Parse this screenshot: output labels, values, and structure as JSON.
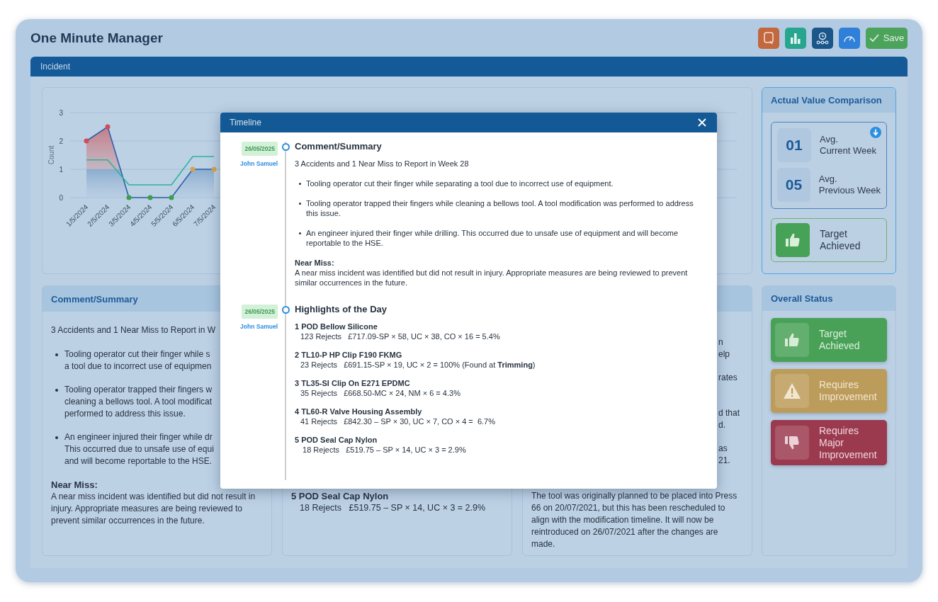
{
  "app": {
    "title": "One Minute Manager"
  },
  "toolbar": [
    {
      "kind": "note"
    },
    {
      "kind": "chart"
    },
    {
      "kind": "timeline"
    },
    {
      "kind": "gauge"
    },
    {
      "kind": "save",
      "label": "Save"
    }
  ],
  "section": {
    "title": "Incident"
  },
  "chart_card": {
    "chart_data": {
      "type": "area",
      "ylabel": "Count",
      "categories": [
        "1/5/2024",
        "2/5/2024",
        "3/5/2024",
        "4/5/2024",
        "5/5/2024",
        "6/5/2024",
        "7/5/2024"
      ],
      "yticks": [
        0,
        1,
        2,
        3
      ],
      "ylim": [
        0,
        3
      ],
      "series": [
        {
          "color": "#2f5ea8",
          "values": [
            2,
            2.5,
            0,
            0,
            0,
            1,
            1
          ],
          "marker": true,
          "type": "area"
        },
        {
          "color": "#2bb39a",
          "values": [
            1.33,
            1.33,
            0.45,
            0.45,
            0.45,
            1.45,
            1.45
          ],
          "marker": false,
          "type": "line"
        }
      ]
    }
  },
  "comparison": {
    "title": "Actual Value Comparison",
    "rows": [
      {
        "value": "01",
        "label": "Avg.\nCurrent Week"
      },
      {
        "value": "05",
        "label": "Avg.\nPrevious Week"
      }
    ],
    "status": {
      "kind": "achieved",
      "label": "Target\nAchieved"
    }
  },
  "cards": [
    {
      "kind": "summary",
      "title": "Comment/Summary",
      "summary": "3 Accidents and 1 Near Miss to Report in W",
      "bullets": [
        [
          "Tooling operator cut their finger while s",
          "a tool due to incorrect use of equipmen"
        ],
        [
          "Tooling operator trapped their fingers w",
          "cleaning a bellows tool. A tool modificat",
          "performed to address this issue."
        ],
        [
          "An engineer injured their finger while dr",
          "This occurred due to unsafe use of equi",
          "and will become reportable to the HSE."
        ]
      ],
      "subheading": "Near Miss:",
      "text": "A near miss incident was identified but did not result in injury. Appropriate measures are being reviewed to prevent similar occurrences in the future."
    },
    {
      "kind": "highlights",
      "items": [
        {
          "title": "5 POD Seal Cap Nylon",
          "detail": "18 Rejects   £519.75 – SP × 14, UC × 3 = 2.9%"
        }
      ]
    },
    {
      "kind": "notes",
      "fragments": [
        [
          "n",
          "elp"
        ],
        [
          "rates"
        ],
        [
          "d that",
          "d."
        ],
        [
          "as",
          "21."
        ]
      ],
      "text": "The tool was originally planned to be placed into Press 66 on 20/07/2021, but this has been rescheduled to align with the modification timeline. It will now be reintroduced on 26/07/2021 after the changes are made."
    }
  ],
  "overall_status": {
    "title": "Overall Status",
    "options": [
      {
        "kind": "achieved",
        "label": "Target\nAchieved"
      },
      {
        "kind": "improvement",
        "label": "Requires\nImprovement"
      },
      {
        "kind": "major",
        "label": "Requires\nMajor\nImprovement"
      }
    ]
  },
  "timeline": {
    "title": "Timeline",
    "entries": [
      {
        "kind": "summary",
        "date": "26/05/2025",
        "author": "John Samuel",
        "title": "Comment/Summary",
        "summary": "3 Accidents and 1 Near Miss to Report in Week 28",
        "bullets": [
          "Tooling operator cut their finger while separating a tool due to incorrect use of equipment.",
          "Tooling operator trapped their fingers while cleaning a bellows tool. A tool modification was performed to address this issue.",
          "An engineer injured their finger while drilling. This occurred due to unsafe use of equipment and will become reportable to the HSE."
        ],
        "subheading": "Near Miss:",
        "text": "A near miss incident was identified but did not result in injury. Appropriate measures are being reviewed to prevent similar occurrences in the future."
      },
      {
        "kind": "highlights",
        "date": "26/05/2025",
        "author": "John Samuel",
        "title": "Highlights of the Day",
        "items": [
          {
            "title": "1 POD Bellow Silicone",
            "detail": "123 Rejects   £717.09-SP × 58, UC × 38, CO × 16 = 5.4%"
          },
          {
            "title": "2 TL10-P HP Clip F190 FKMG",
            "detail": "23 Rejects   £691.15-SP × 19, UC × 2 = 100% (Found at **Trimming**)"
          },
          {
            "title": "3 TL35-SI Clip On E271 EPDMC",
            "detail": "35 Rejects   £668.50-MC × 24, NM × 6 = 4.3%"
          },
          {
            "title": "4 TL60-R Valve Housing Assembly",
            "detail": "41 Rejects   £842.30 – SP × 30, UC × 7, CO × 4 =  6.7%"
          },
          {
            "title": "5 POD Seal Cap Nylon",
            "detail": " 18 Rejects   £519.75 – SP × 14, UC × 3 = 2.9%"
          }
        ]
      }
    ]
  }
}
